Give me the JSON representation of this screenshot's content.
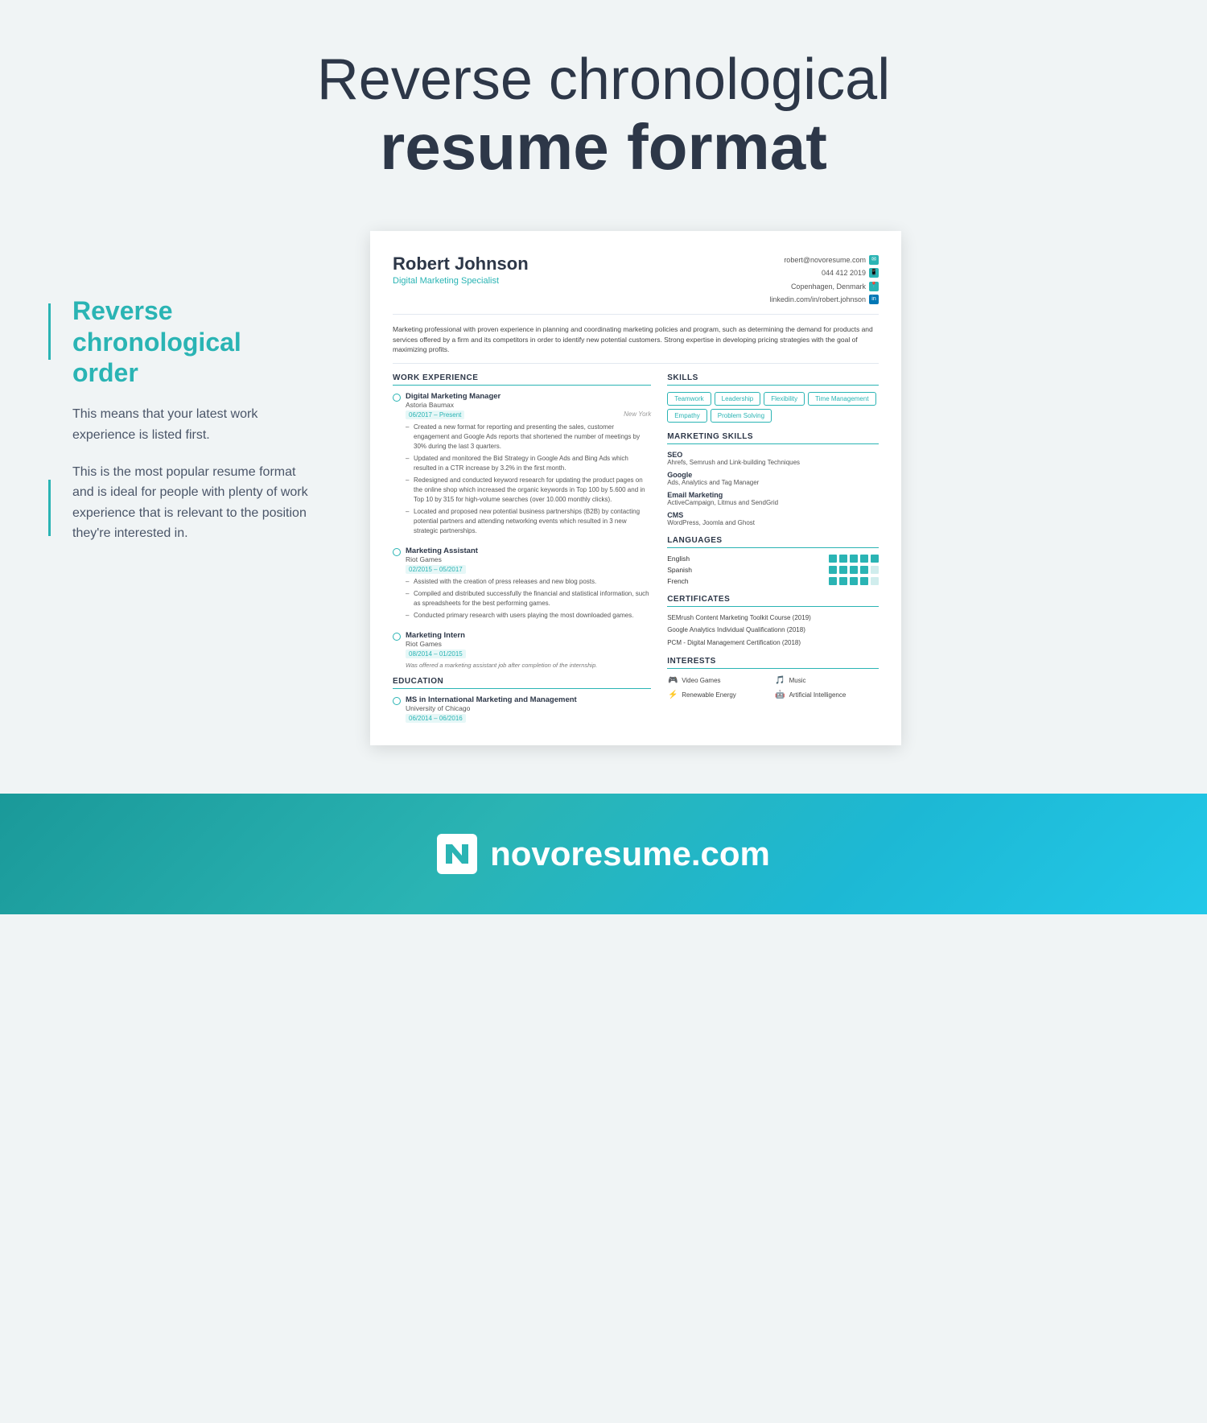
{
  "header": {
    "title_light": "Reverse chronological",
    "title_bold": "resume format"
  },
  "sidebar": {
    "heading": "Reverse chronological order",
    "para1": "This means that your latest work experience is listed first.",
    "para2": "This is the most popular resume format and is ideal for people with plenty of work experience that is relevant to the position they're interested in."
  },
  "resume": {
    "name": "Robert Johnson",
    "title": "Digital Marketing Specialist",
    "contact": {
      "email": "robert@novoresume.com",
      "phone": "044 412 2019",
      "location": "Copenhagen, Denmark",
      "linkedin": "linkedin.com/in/robert.johnson"
    },
    "summary": "Marketing professional with proven experience in planning and coordinating marketing policies and program, such as determining the demand for products and services offered by a firm and its competitors in order to identify new potential customers. Strong expertise in developing pricing strategies with the goal of maximizing profits.",
    "work_experience_label": "WORK EXPERIENCE",
    "jobs": [
      {
        "title": "Digital Marketing Manager",
        "company": "Astoria Baumax",
        "dates": "06/2017 – Present",
        "location": "New York",
        "bullets": [
          "Created a new format for reporting and presenting the sales, customer engagement and Google Ads reports that shortened the number of meetings by 30% during the last 3 quarters.",
          "Updated and monitored the Bid Strategy in Google Ads and Bing Ads which resulted in a CTR increase by 3.2% in the first month.",
          "Redesigned and conducted keyword research for updating the product pages on the online shop which increased the organic keywords in Top 100 by 5.600 and in Top 10 by 315 for high-volume searches (over 10.000 monthly clicks).",
          "Located and proposed new potential business partnerships (B2B) by contacting potential partners and attending networking events which resulted in 3 new strategic partnerships."
        ]
      },
      {
        "title": "Marketing Assistant",
        "company": "Riot Games",
        "dates": "02/2015 – 05/2017",
        "location": "",
        "bullets": [
          "Assisted with the creation of press releases and new blog posts.",
          "Compiled and distributed successfully the financial and statistical information, such as spreadsheets for the best performing games.",
          "Conducted primary research with users playing the most downloaded games."
        ]
      },
      {
        "title": "Marketing Intern",
        "company": "Riot Games",
        "dates": "08/2014 – 01/2015",
        "location": "",
        "bullets": [],
        "note": "Was offered a marketing assistant job after completion of the internship."
      }
    ],
    "education_label": "EDUCATION",
    "education": [
      {
        "degree": "MS in International Marketing and Management",
        "school": "University of Chicago",
        "dates": "06/2014 – 06/2016"
      }
    ],
    "skills_label": "SKILLS",
    "skills": [
      "Teamwork",
      "Leadership",
      "Flexibility",
      "Time Management",
      "Empathy",
      "Problem Solving"
    ],
    "marketing_skills_label": "MARKETING SKILLS",
    "marketing_skills": [
      {
        "title": "SEO",
        "desc": "Ahrefs, Semrush and Link-building Techniques"
      },
      {
        "title": "Google",
        "desc": "Ads, Analytics and Tag Manager"
      },
      {
        "title": "Email Marketing",
        "desc": "ActiveCampaign, Litmus and SendGrid"
      },
      {
        "title": "CMS",
        "desc": "WordPress, Joomla and Ghost"
      }
    ],
    "languages_label": "LANGUAGES",
    "languages": [
      {
        "name": "English",
        "level": 5
      },
      {
        "name": "Spanish",
        "level": 4
      },
      {
        "name": "French",
        "level": 4
      }
    ],
    "certificates_label": "CERTIFICATES",
    "certificates": [
      "SEMrush Content Marketing Toolkit Course (2019)",
      "Google Analytics Individual Qualificationn (2018)",
      "PCM - Digital Management Certification (2018)"
    ],
    "interests_label": "INTERESTS",
    "interests": [
      {
        "icon": "🎮",
        "label": "Video Games"
      },
      {
        "icon": "🎵",
        "label": "Music"
      },
      {
        "icon": "⚡",
        "label": "Renewable Energy"
      },
      {
        "icon": "🤖",
        "label": "Artificial Intelligence"
      }
    ]
  },
  "footer": {
    "brand": "novoresume.com"
  }
}
